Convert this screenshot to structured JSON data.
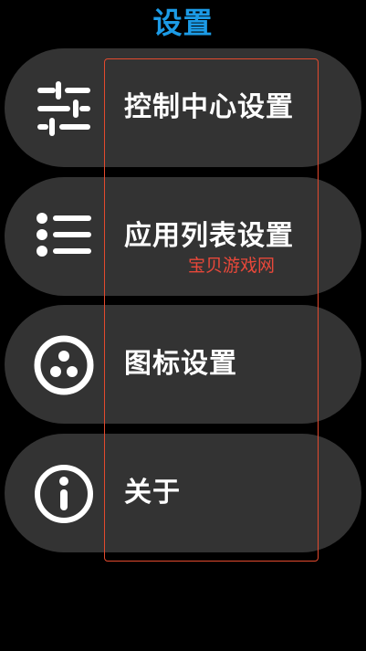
{
  "page": {
    "title": "设置"
  },
  "menu": {
    "items": [
      {
        "label": "控制中心设置",
        "icon": "sliders-icon"
      },
      {
        "label": "应用列表设置",
        "icon": "list-icon"
      },
      {
        "label": "图标设置",
        "icon": "dots-circle-icon"
      },
      {
        "label": "关于",
        "icon": "info-icon"
      }
    ]
  },
  "overlay": {
    "watermark": "宝贝游戏网"
  },
  "colors": {
    "title": "#1c9be6",
    "item_background": "#333333",
    "background": "#000000",
    "highlight_border": "#e34a2e",
    "watermark": "#e8483a"
  }
}
